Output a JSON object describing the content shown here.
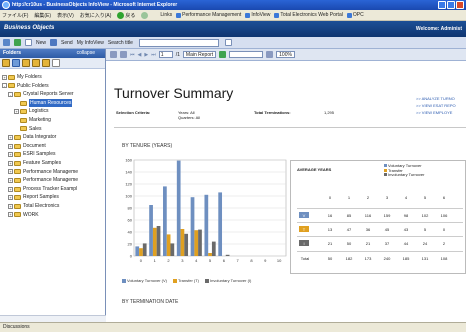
{
  "window": {
    "title": "http://cr10us - BusinessObjects InfoView - Microsoft Internet Explorer"
  },
  "menubar": {
    "items": [
      "ファイル(F)",
      "編集(E)",
      "表示(V)",
      "お気に入り(A)"
    ],
    "nav": "戻る",
    "links_label": "Links",
    "links": [
      "Performance Management",
      "InfoView",
      "Total Electronics Web Portal",
      "OPC"
    ]
  },
  "header": {
    "brand": "Business Objects",
    "welcome": "Welcome: Administ"
  },
  "toolbar": {
    "new_label": "New",
    "send_label": "Send",
    "infoview_label": "My InfoView",
    "search_label": "Search title"
  },
  "left_panel": {
    "title": "Folders",
    "collapse_label": "collapse",
    "tree": [
      {
        "label": "My Folders",
        "level": 0,
        "exp": "+"
      },
      {
        "label": "Public Folders",
        "level": 0,
        "exp": "-"
      },
      {
        "label": "Crystal Reports Server",
        "level": 1,
        "exp": "-"
      },
      {
        "label": "Human Resources",
        "level": 2,
        "exp": "",
        "selected": true
      },
      {
        "label": "Logistics",
        "level": 2,
        "exp": "+"
      },
      {
        "label": "Marketing",
        "level": 2,
        "exp": ""
      },
      {
        "label": "Sales",
        "level": 2,
        "exp": ""
      },
      {
        "label": "Data Integrator",
        "level": 1,
        "exp": "+"
      },
      {
        "label": "Document",
        "level": 1,
        "exp": "+"
      },
      {
        "label": "ESRI Samples",
        "level": 1,
        "exp": "+"
      },
      {
        "label": "Feature Samples",
        "level": 1,
        "exp": "+"
      },
      {
        "label": "Performance Manageme",
        "level": 1,
        "exp": "+"
      },
      {
        "label": "Performance Manageme",
        "level": 1,
        "exp": "+"
      },
      {
        "label": "Process Tracker Exampl",
        "level": 1,
        "exp": "+"
      },
      {
        "label": "Report Samples",
        "level": 1,
        "exp": "+"
      },
      {
        "label": "Total Electronics",
        "level": 1,
        "exp": "+"
      },
      {
        "label": "WORK",
        "level": 1,
        "exp": "+"
      }
    ]
  },
  "report_toolbar": {
    "page_value": "1",
    "page_total": "/1",
    "view_select": "Main Report",
    "zoom": "100%"
  },
  "report": {
    "title": "Turnover Summary",
    "links": [
      ">> ANALYZE TURNO",
      ">> VIEW ESAT REPO",
      ">> VIEW EMPLOYE"
    ],
    "criteria_label": "Selection Criteria:",
    "criteria_years": "Years: All",
    "criteria_quarters": "Quarters: All",
    "total_label": "Total Terminations:",
    "total_value": "1,295",
    "section1": "BY TENURE (YEARS)",
    "section2": "BY TERMINATION DATE",
    "legend": [
      "Voluntary Turnover (V)",
      "Transfer (T)",
      "Involuntary Turnover (I)"
    ]
  },
  "colors": {
    "voluntary": "#6e8fc0",
    "transfer": "#e0a020",
    "involuntary": "#6a6a6a"
  },
  "chart_data": {
    "type": "bar",
    "categories": [
      "0",
      "1",
      "2",
      "3",
      "4",
      "5",
      "6",
      "7",
      "8",
      "9",
      "10"
    ],
    "series": [
      {
        "name": "Voluntary Turnover (V)",
        "values": [
          16,
          85,
          116,
          159,
          98,
          102,
          106,
          0,
          0,
          0,
          0
        ]
      },
      {
        "name": "Transfer (T)",
        "values": [
          13,
          47,
          36,
          45,
          43,
          5,
          0,
          0,
          0,
          0,
          0
        ]
      },
      {
        "name": "Involuntary Turnover (I)",
        "values": [
          21,
          50,
          21,
          37,
          44,
          24,
          2,
          0,
          0,
          0,
          0
        ]
      }
    ],
    "ylim": [
      0,
      160
    ],
    "yticks": [
      "0",
      "20",
      "40",
      "60",
      "80",
      "100",
      "120",
      "140",
      "160"
    ],
    "grid": true,
    "legend": "bottom"
  },
  "table": {
    "header": "AVERAGE YEARS",
    "legend": [
      "Voluntary Turnover",
      "Transfer",
      "Involuntary Turnover"
    ],
    "columns": [
      "0",
      "1",
      "2",
      "3",
      "4",
      "5",
      "6"
    ],
    "rows": [
      {
        "label": "V",
        "values": [
          "16",
          "85",
          "116",
          "159",
          "98",
          "102",
          "106"
        ]
      },
      {
        "label": "T",
        "values": [
          "13",
          "47",
          "36",
          "45",
          "43",
          "5",
          "0"
        ]
      },
      {
        "label": "I",
        "values": [
          "21",
          "50",
          "21",
          "37",
          "44",
          "24",
          "2"
        ]
      },
      {
        "label": "Total",
        "values": [
          "50",
          "182",
          "173",
          "240",
          "185",
          "131",
          "108"
        ]
      }
    ]
  },
  "status": {
    "text": "Discussions"
  }
}
